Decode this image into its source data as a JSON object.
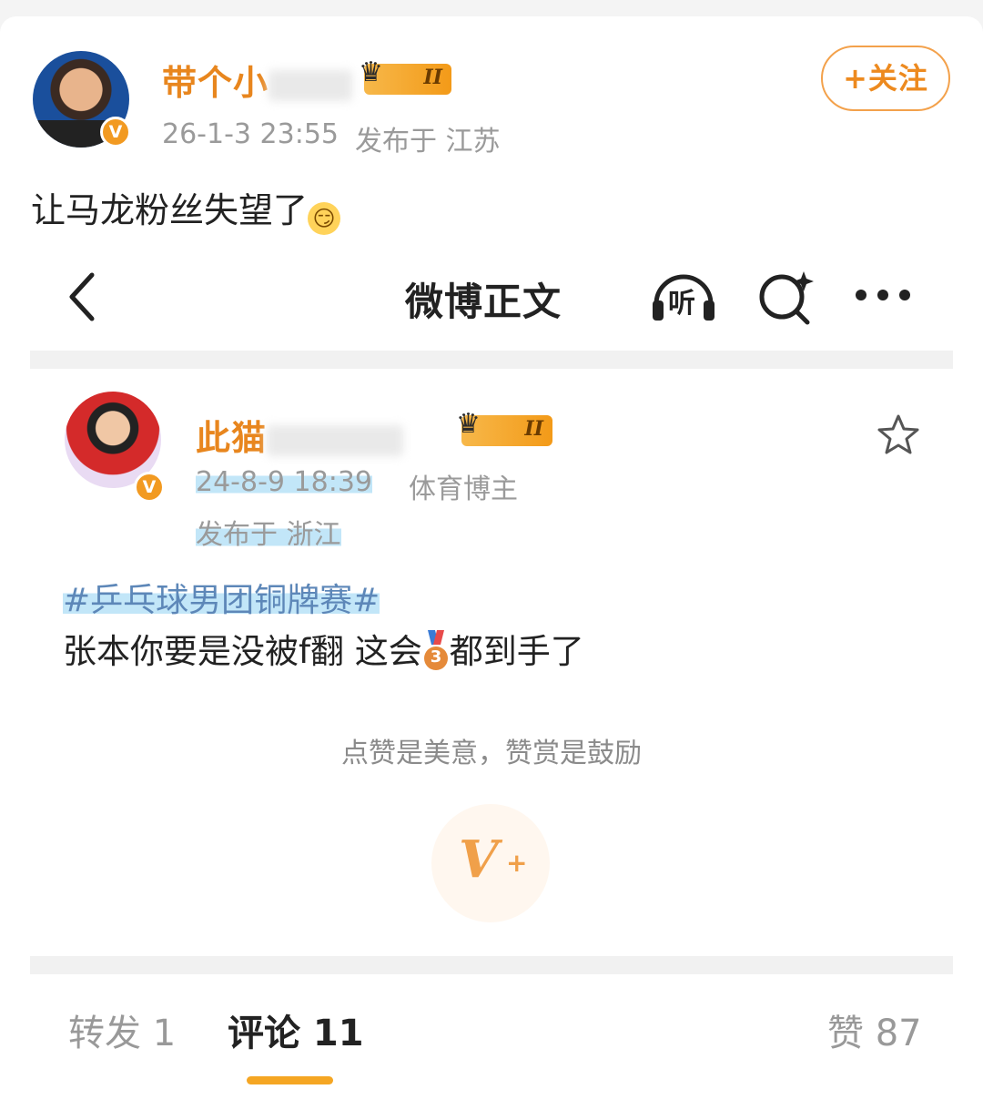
{
  "post": {
    "author": {
      "name": "带个小",
      "level": "II"
    },
    "time": "26-1-3 23:55",
    "location": "发布于 江苏",
    "follow_label": "+关注",
    "text": "让马龙粉丝失望了",
    "emoji": "😏"
  },
  "embedded": {
    "nav": {
      "title": "微博正文",
      "listen_label": "听"
    },
    "author": {
      "name": "此猫",
      "level": "II"
    },
    "time": "24-8-9 18:39",
    "role": "体育博主",
    "location": "发布于 浙江",
    "topic": "#乒乓球男团铜牌赛#",
    "body_before": "张本你要是没被f翻 这会",
    "medal": "3",
    "body_after": "都到手了",
    "reward_tip": "点赞是美意，赞赏是鼓励",
    "tabs": [
      {
        "label": "转发 1"
      },
      {
        "label": "评论 11"
      },
      {
        "label": "赞 87"
      }
    ]
  }
}
